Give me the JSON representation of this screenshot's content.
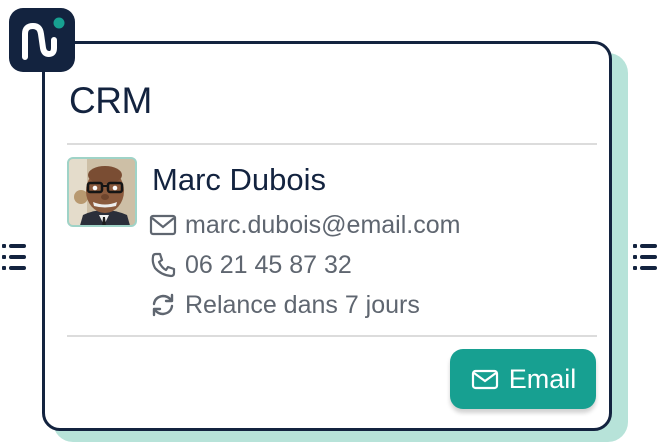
{
  "card": {
    "title": "CRM",
    "accent_color": "#17a091",
    "border_color": "#13233f",
    "shadow_color": "#b7e3d9"
  },
  "logo": {
    "icon": "brand-logo-icon",
    "background": "#13233f"
  },
  "contact": {
    "avatar": "contact-avatar",
    "name": "Marc Dubois",
    "email": "marc.dubois@email.com",
    "phone": "06 21 45 87 32",
    "follow_up": "Relance dans 7 jours"
  },
  "actions": {
    "email_button_label": "Email"
  },
  "handles": {
    "left_icon": "drag-handle-icon",
    "right_icon": "drag-handle-icon"
  }
}
